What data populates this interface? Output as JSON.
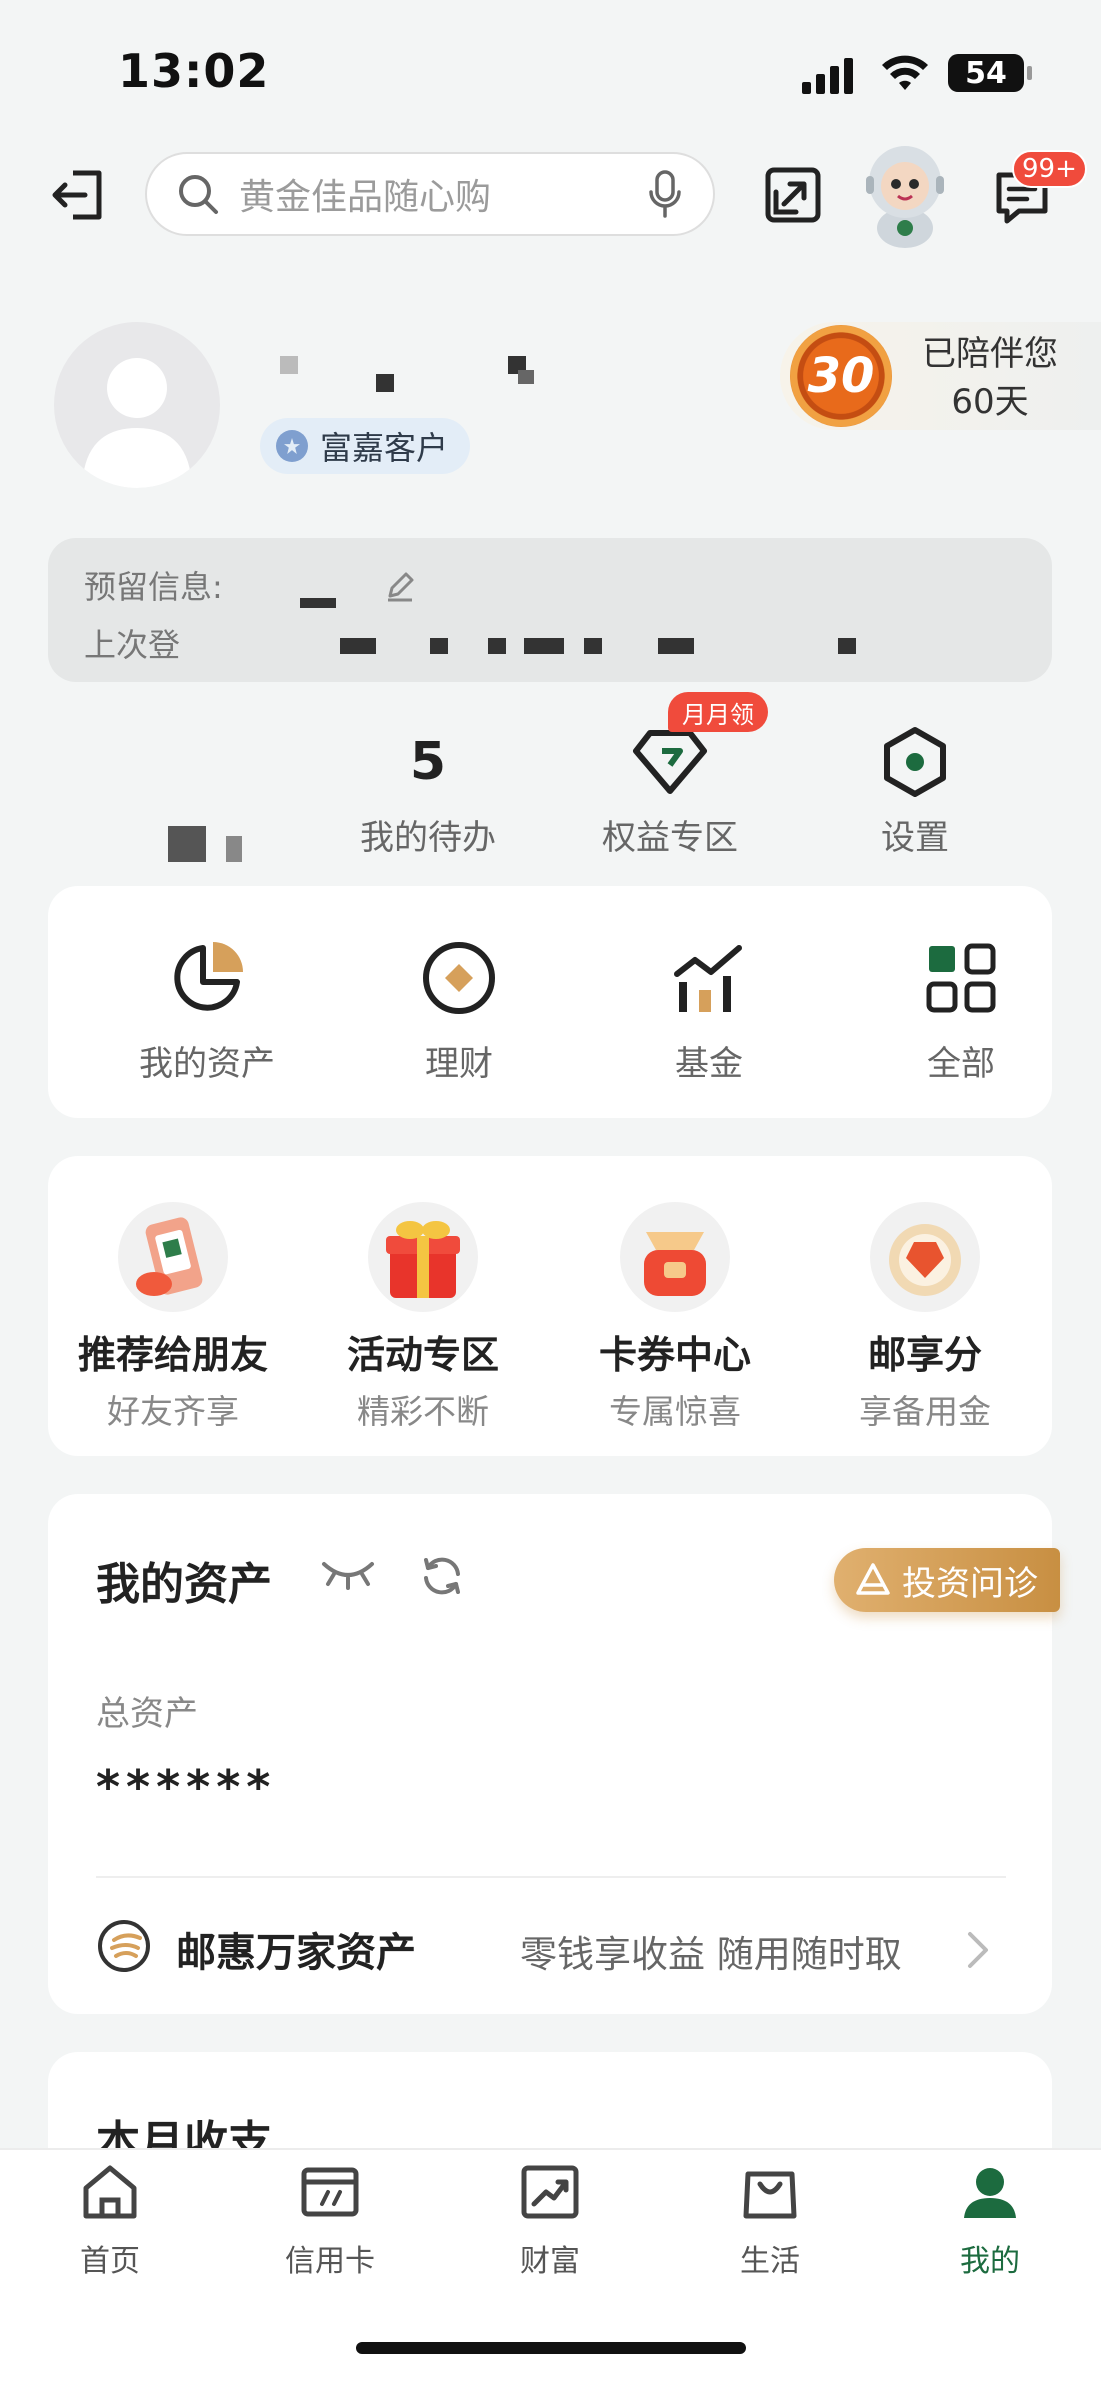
{
  "status_bar": {
    "time": "13:02",
    "battery": "54"
  },
  "header": {
    "search_placeholder": "黄金佳品随心购",
    "message_badge": "99+"
  },
  "profile": {
    "vip_label": "富嘉客户",
    "companion_line1": "已陪伴您",
    "companion_line2": "60天",
    "medal_number": "30"
  },
  "info": {
    "reserved_label": "预留信息:",
    "last_login_label": "上次登"
  },
  "quick_row": {
    "todo_count": "5",
    "todo_label": "我的待办",
    "rights_label": "权益专区",
    "rights_badge": "月月领",
    "settings_label": "设置"
  },
  "grid": [
    {
      "label": "我的资产"
    },
    {
      "label": "理财"
    },
    {
      "label": "基金"
    },
    {
      "label": "全部"
    }
  ],
  "promos": [
    {
      "title": "推荐给朋友",
      "sub": "好友齐享"
    },
    {
      "title": "活动专区",
      "sub": "精彩不断"
    },
    {
      "title": "卡券中心",
      "sub": "专属惊喜"
    },
    {
      "title": "邮享分",
      "sub": "享备用金"
    }
  ],
  "assets": {
    "title": "我的资产",
    "invest_button": "投资问诊",
    "total_label": "总资产",
    "total_value": "******",
    "product_title": "邮惠万家资产",
    "product_desc": "零钱享收益 随用随时取"
  },
  "month": {
    "title": "本月收支"
  },
  "tabs": [
    {
      "label": "首页"
    },
    {
      "label": "信用卡"
    },
    {
      "label": "财富"
    },
    {
      "label": "生活"
    },
    {
      "label": "我的"
    }
  ],
  "colors": {
    "accent": "#1c6b3f",
    "badge": "#f04b3c",
    "gold": "#d6a05b"
  }
}
